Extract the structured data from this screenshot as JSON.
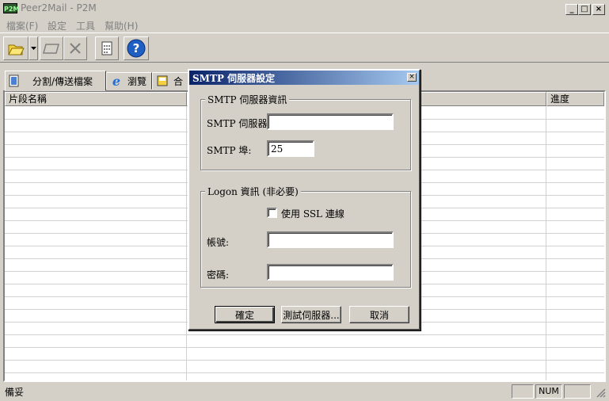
{
  "window": {
    "title": "Peer2Mail - P2M",
    "icon_text": "P2M"
  },
  "menu": [
    "檔案(F)",
    "設定",
    "工具",
    "幫助(H)"
  ],
  "toolbar": [
    "open-icon",
    "dropdown-icon",
    "folder-icon",
    "delete-icon",
    "split-icon",
    "help-icon"
  ],
  "tabs": {
    "split": "分割/傳送檔案",
    "browse": "瀏覽",
    "merge": "合"
  },
  "table": {
    "col_name": "片段名稱",
    "col_progress": "進度"
  },
  "status": {
    "text": "備妥",
    "num": "NUM"
  },
  "dialog": {
    "title": "SMTP 伺服器設定",
    "smtp_group": "SMTP 伺服器資訊",
    "smtp_server_label": "SMTP 伺服器",
    "smtp_server_value": "",
    "smtp_port_label": "SMTP 埠:",
    "smtp_port_value": "25",
    "logon_group": "Logon 資訊 (非必要)",
    "ssl_label": "使用 SSL 連線",
    "ssl_checked": false,
    "account_label": "帳號:",
    "account_value": "",
    "password_label": "密碼:",
    "password_value": "",
    "ok": "確定",
    "test": "測試伺服器...",
    "cancel": "取消"
  }
}
